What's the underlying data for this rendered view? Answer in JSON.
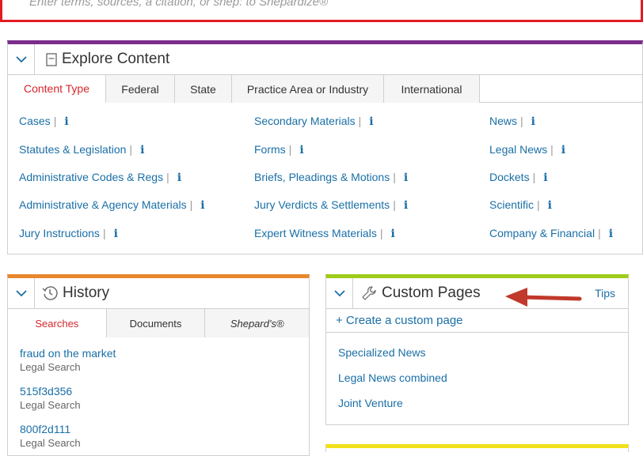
{
  "search": {
    "placeholder": "Enter terms, sources, a citation, or shep: to Shepardize®"
  },
  "explore": {
    "title": "Explore Content",
    "tabs": [
      "Content Type",
      "Federal",
      "State",
      "Practice Area or Industry",
      "International"
    ],
    "info_glyph": "i",
    "separator": "|",
    "columns": [
      [
        "Cases",
        "Statutes & Legislation",
        "Administrative Codes & Regs",
        "Administrative & Agency Materials",
        "Jury Instructions"
      ],
      [
        "Secondary Materials",
        "Forms",
        "Briefs, Pleadings & Motions",
        "Jury Verdicts & Settlements",
        "Expert Witness Materials"
      ],
      [
        "News",
        "Legal News",
        "Dockets",
        "Scientific",
        "Company & Financial"
      ]
    ]
  },
  "history": {
    "title": "History",
    "tabs": [
      "Searches",
      "Documents",
      "Shepard's®"
    ],
    "items": [
      {
        "link": "fraud on the market",
        "type": "Legal Search"
      },
      {
        "link": "515f3d356",
        "type": "Legal Search"
      },
      {
        "link": "800f2d111",
        "type": "Legal Search"
      }
    ]
  },
  "custom": {
    "title": "Custom Pages",
    "tips": "Tips",
    "create": "+ Create a custom page",
    "items": [
      "Specialized News",
      "Legal News combined",
      "Joint Venture"
    ]
  },
  "colors": {
    "accent_red": "#e31b23",
    "explore_bar": "#7b2d8b",
    "history_bar": "#e8872e",
    "custom_bar": "#9fcb1b",
    "yellow_bar": "#f2e01a",
    "link": "#1a6fa6",
    "arrow": "#c0392b"
  },
  "icons": {
    "collapse": "chevron-down-icon",
    "explore": "document-icon",
    "history": "history-clock-icon",
    "custom": "wrench-icon",
    "annotation": "arrow-left-icon"
  }
}
